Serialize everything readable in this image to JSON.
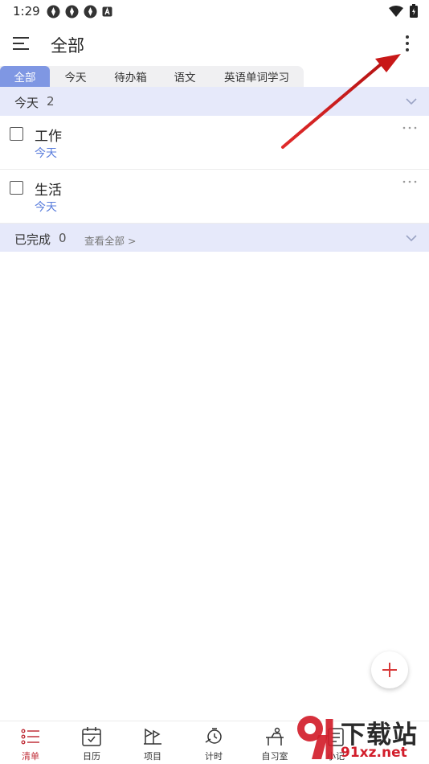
{
  "status_bar": {
    "time": "1:29"
  },
  "header": {
    "title": "全部"
  },
  "tabs": [
    {
      "label": "全部",
      "active": true
    },
    {
      "label": "今天",
      "active": false
    },
    {
      "label": "待办箱",
      "active": false
    },
    {
      "label": "语文",
      "active": false
    },
    {
      "label": "英语单词学习",
      "active": false
    }
  ],
  "today_section": {
    "title": "今天",
    "count": "2",
    "tasks": [
      {
        "title": "工作",
        "date": "今天"
      },
      {
        "title": "生活",
        "date": "今天"
      }
    ]
  },
  "done_section": {
    "title": "已完成",
    "count": "0",
    "link": "查看全部 >"
  },
  "bottom_nav": [
    {
      "label": "清单",
      "icon": "list-icon",
      "active": true
    },
    {
      "label": "日历",
      "icon": "calendar-icon",
      "active": false
    },
    {
      "label": "项目",
      "icon": "project-icon",
      "active": false
    },
    {
      "label": "计时",
      "icon": "timer-icon",
      "active": false
    },
    {
      "label": "自习室",
      "icon": "study-room-icon",
      "active": false
    },
    {
      "label": "小记",
      "icon": "note-icon",
      "active": false
    }
  ],
  "watermark": {
    "top": "下载站",
    "bottom": "91xz.net"
  },
  "colors": {
    "accent": "#7f97e3",
    "section_bg": "#e6e9fa",
    "date_text": "#5a7ddc",
    "nav_active": "#c0303a",
    "annotation_arrow": "#d42020"
  }
}
